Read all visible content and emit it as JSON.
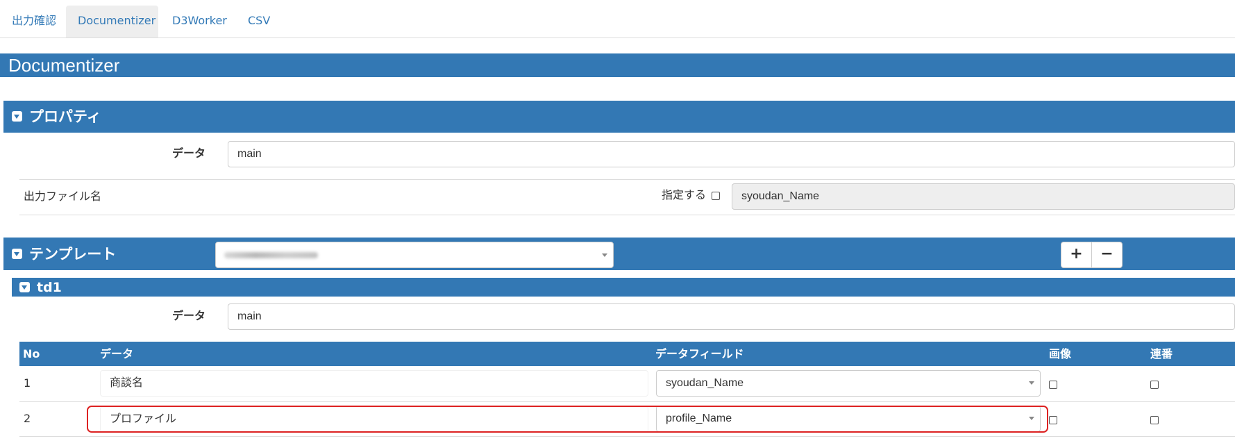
{
  "tabs": [
    {
      "label": "出力確認"
    },
    {
      "label": "Documentizer"
    },
    {
      "label": "D3Worker"
    },
    {
      "label": "CSV"
    }
  ],
  "page_title": "Documentizer",
  "properties": {
    "title": "プロパティ",
    "data_label": "データ",
    "data_value": "main",
    "output_label": "出力ファイル名",
    "specify_label": "指定する",
    "output_value": "syoudan_Name"
  },
  "template": {
    "title": "テンプレート",
    "add_label": "+",
    "remove_label": "−"
  },
  "td1": {
    "title": "td1",
    "data_label": "データ",
    "data_value": "main",
    "columns": [
      "No",
      "データ",
      "データフィールド",
      "画像",
      "連番"
    ],
    "rows": [
      {
        "no": "1",
        "data": "商談名",
        "field": "syoudan_Name"
      },
      {
        "no": "2",
        "data": "プロファイル",
        "field": "profile_Name"
      }
    ]
  },
  "colors": {
    "accent": "#3378b4",
    "link": "#337ab7",
    "highlight": "#dd2222"
  }
}
